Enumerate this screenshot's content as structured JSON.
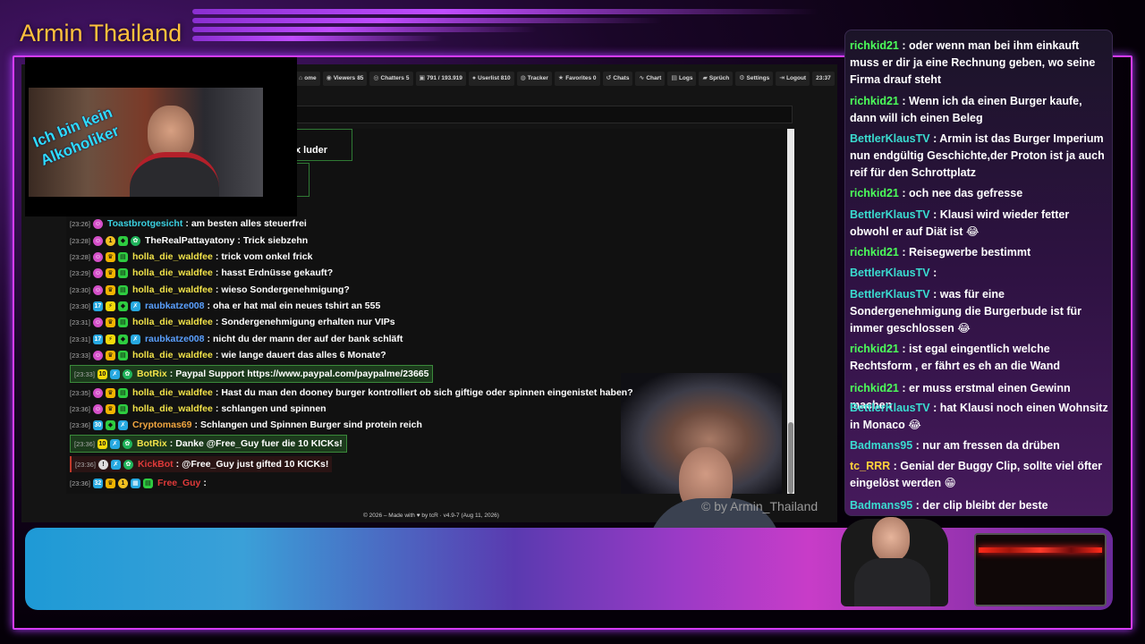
{
  "channel": {
    "title": "Armin Thailand"
  },
  "cam_caption": "Ich bin kein Alkoholiker",
  "nav": [
    {
      "icon": "home-icon",
      "label": "ome"
    },
    {
      "icon": "eye-icon",
      "label": "Viewers",
      "value": "85"
    },
    {
      "icon": "users-icon",
      "label": "Chatters",
      "value": "5"
    },
    {
      "icon": "chat-icon",
      "label": "791 / 193.919"
    },
    {
      "icon": "user-icon",
      "label": "Userlist 810"
    },
    {
      "icon": "tracker-icon",
      "label": "Tracker"
    },
    {
      "icon": "star-icon",
      "label": "Favorites 0"
    },
    {
      "icon": "history-icon",
      "label": "Chats"
    },
    {
      "icon": "chart-icon",
      "label": "Chart"
    },
    {
      "icon": "log-icon",
      "label": "Logs"
    },
    {
      "icon": "speech-icon",
      "label": "Sprüch"
    },
    {
      "icon": "gear-icon",
      "label": "Settings"
    },
    {
      "icon": "logout-icon",
      "label": "Logout"
    },
    {
      "icon": "clock-icon",
      "label": "23:37"
    }
  ],
  "partial_message": "x luder",
  "messages": [
    {
      "time": "[23:26]",
      "user": "Toastbrotgesicht",
      "color": "#3ad0e0",
      "text": "am besten alles steuerfrei"
    },
    {
      "time": "[23:28]",
      "user": "TheRealPattayatony",
      "color": "#ffffff",
      "text": "Trick siebzehn"
    },
    {
      "time": "[23:28]",
      "user": "holla_die_waldfee",
      "color": "#f2e34a",
      "text": "trick vom onkel frick"
    },
    {
      "time": "[23:29]",
      "user": "holla_die_waldfee",
      "color": "#f2e34a",
      "text": "hasst Erdnüsse gekauft?"
    },
    {
      "time": "[23:30]",
      "user": "holla_die_waldfee",
      "color": "#f2e34a",
      "text": "wieso Sondergenehmigung?"
    },
    {
      "time": "[23:30]",
      "user": "raubkatze008",
      "color": "#5aa0ff",
      "text": "oha er hat mal ein neues tshirt an 555"
    },
    {
      "time": "[23:31]",
      "user": "holla_die_waldfee",
      "color": "#f2e34a",
      "text": "Sondergenehmigung erhalten nur VIPs"
    },
    {
      "time": "[23:31]",
      "user": "raubkatze008",
      "color": "#5aa0ff",
      "text": "nicht du der mann der auf der bank schläft"
    },
    {
      "time": "[23:33]",
      "user": "holla_die_waldfee",
      "color": "#f2e34a",
      "text": "wie lange dauert das alles 6 Monate?"
    },
    {
      "time": "[23:33]",
      "user": "BotRix",
      "color": "#f2e34a",
      "text": "Paypal Support https://www.paypal.com/paypalme/23665",
      "bot": true
    },
    {
      "time": "[23:35]",
      "user": "holla_die_waldfee",
      "color": "#f2e34a",
      "text": "Hast du man den dooney burger kontrolliert ob sich giftige oder spinnen eingenistet haben?"
    },
    {
      "time": "[23:36]",
      "user": "holla_die_waldfee",
      "color": "#f2e34a",
      "text": "schlangen und spinnen"
    },
    {
      "time": "[23:36]",
      "user": "Cryptomas69",
      "color": "#f2a640",
      "text": "Schlangen und Spinnen Burger sind protein reich"
    },
    {
      "time": "[23:36]",
      "user": "BotRix",
      "color": "#f2e34a",
      "text": "Danke @Free_Guy fuer die 10 KICKs!",
      "bot": true
    },
    {
      "time": "[23:36]",
      "user": "KickBot",
      "color": "#e03a3a",
      "text": "@Free_Guy just gifted 10 KICKs!",
      "kick": true
    },
    {
      "time": "[23:36]",
      "user": "Free_Guy",
      "color": "#e03a3a",
      "text": ""
    }
  ],
  "footer": "© 2026 – Made with ♥ by tcR · v4.9-7 (Aug 11, 2026)",
  "watermark": "© by Armin_Thailand",
  "side_chat": [
    {
      "user": "richkid21",
      "color": "#4cff5a",
      "text": "oder wenn man bei ihm einkauft muss er dir ja eine Rechnung geben, wo seine Firma drauf steht"
    },
    {
      "user": "richkid21",
      "color": "#4cff5a",
      "text": "Wenn ich da einen Burger kaufe, dann will ich einen Beleg"
    },
    {
      "user": "BettlerKlausTV",
      "color": "#3adcd0",
      "text": "Armin ist das Burger Imperium nun endgültig Geschichte,der Proton ist ja auch reif für den Schrottplatz"
    },
    {
      "user": "richkid21",
      "color": "#4cff5a",
      "text": "och nee das gefresse"
    },
    {
      "user": "BettlerKlausTV",
      "color": "#3adcd0",
      "text": "Klausi wird wieder fetter obwohl er auf Diät ist 😂"
    },
    {
      "user": "richkid21",
      "color": "#4cff5a",
      "text": "Reisegwerbe bestimmt"
    },
    {
      "user": "BettlerKlausTV",
      "color": "#3adcd0",
      "text": ""
    },
    {
      "user": "BettlerKlausTV",
      "color": "#3adcd0",
      "text": "was für eine Sondergenehmigung die Burgerbude ist für immer geschlossen 😂"
    },
    {
      "user": "richkid21",
      "color": "#4cff5a",
      "text": "ist egal eingentlich welche Rechtsform , er fährt es eh an die Wand"
    },
    {
      "user": "richkid21",
      "color": "#4cff5a",
      "text": "er muss erstmal einen Gewinn machen"
    },
    {
      "user": "BettlerKlausTV",
      "color": "#3adcd0",
      "text": "hat Klausi noch einen Wohnsitz in Monaco 😂"
    },
    {
      "user": "Badmans95",
      "color": "#3adcd0",
      "text": "nur am fressen da drüben"
    },
    {
      "user": "tc_RRR",
      "color": "#ffd23a",
      "text": "Genial der Buggy Clip, sollte viel öfter eingelöst werden 😁"
    },
    {
      "user": "Badmans95",
      "color": "#3adcd0",
      "text": "der clip bleibt der beste"
    }
  ]
}
